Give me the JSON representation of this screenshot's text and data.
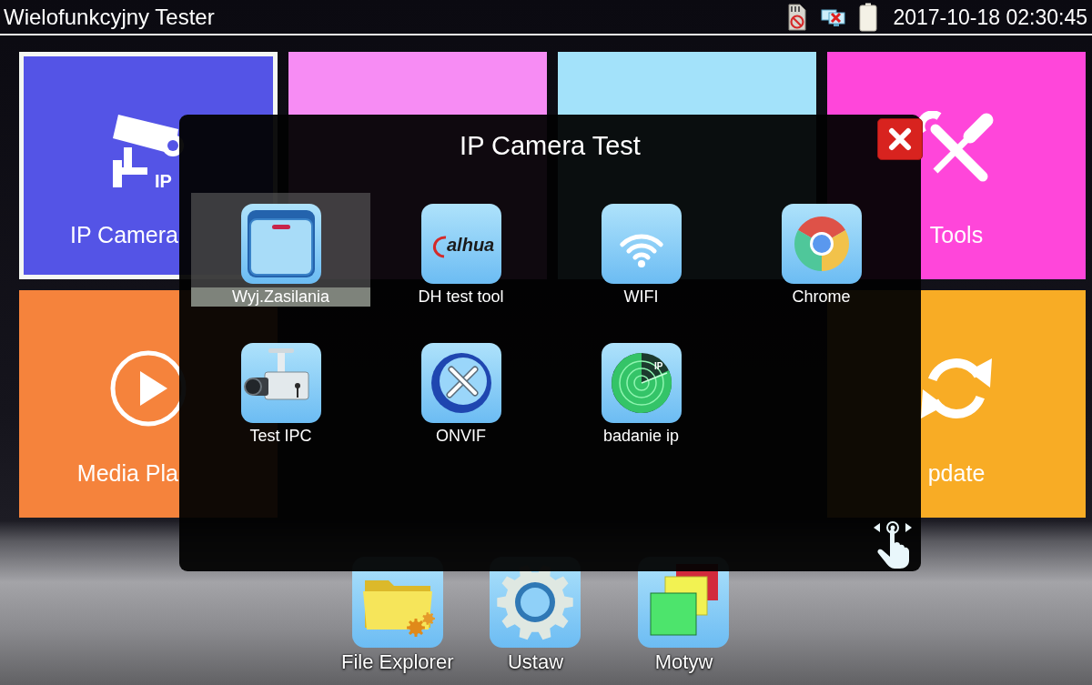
{
  "status_bar": {
    "title": "Wielofunkcyjny Tester",
    "clock": "2017-10-18 02:30:45"
  },
  "tiles": [
    {
      "label": "IP Camera",
      "icon_text": "IP",
      "color": "#5454e6",
      "selected": true
    },
    {
      "color": "#f78cf4",
      "selected": false
    },
    {
      "color": "#a3e2fa",
      "selected": false
    },
    {
      "label": "Tools",
      "color": "#ff46da",
      "selected": false
    },
    {
      "label": "Media Pla",
      "color": "#f5833c",
      "selected": false
    },
    {
      "label": "pdate",
      "color": "#f8ac25",
      "selected": false
    }
  ],
  "dialog": {
    "title": "IP Camera Test",
    "apps": [
      {
        "label": "Wyj.Zasilania",
        "selected": true
      },
      {
        "label": "DH test tool",
        "logo_text": "alhua",
        "selected": false
      },
      {
        "label": "WIFI",
        "selected": false
      },
      {
        "label": "Chrome",
        "selected": false
      },
      {
        "label": "Test IPC",
        "selected": false
      },
      {
        "label": "ONVIF",
        "selected": false
      },
      {
        "label": "badanie ip",
        "icon_text": "IP",
        "selected": false
      }
    ]
  },
  "dock": [
    {
      "label": "File Explorer"
    },
    {
      "label": "Ustaw"
    },
    {
      "label": "Motyw"
    }
  ]
}
